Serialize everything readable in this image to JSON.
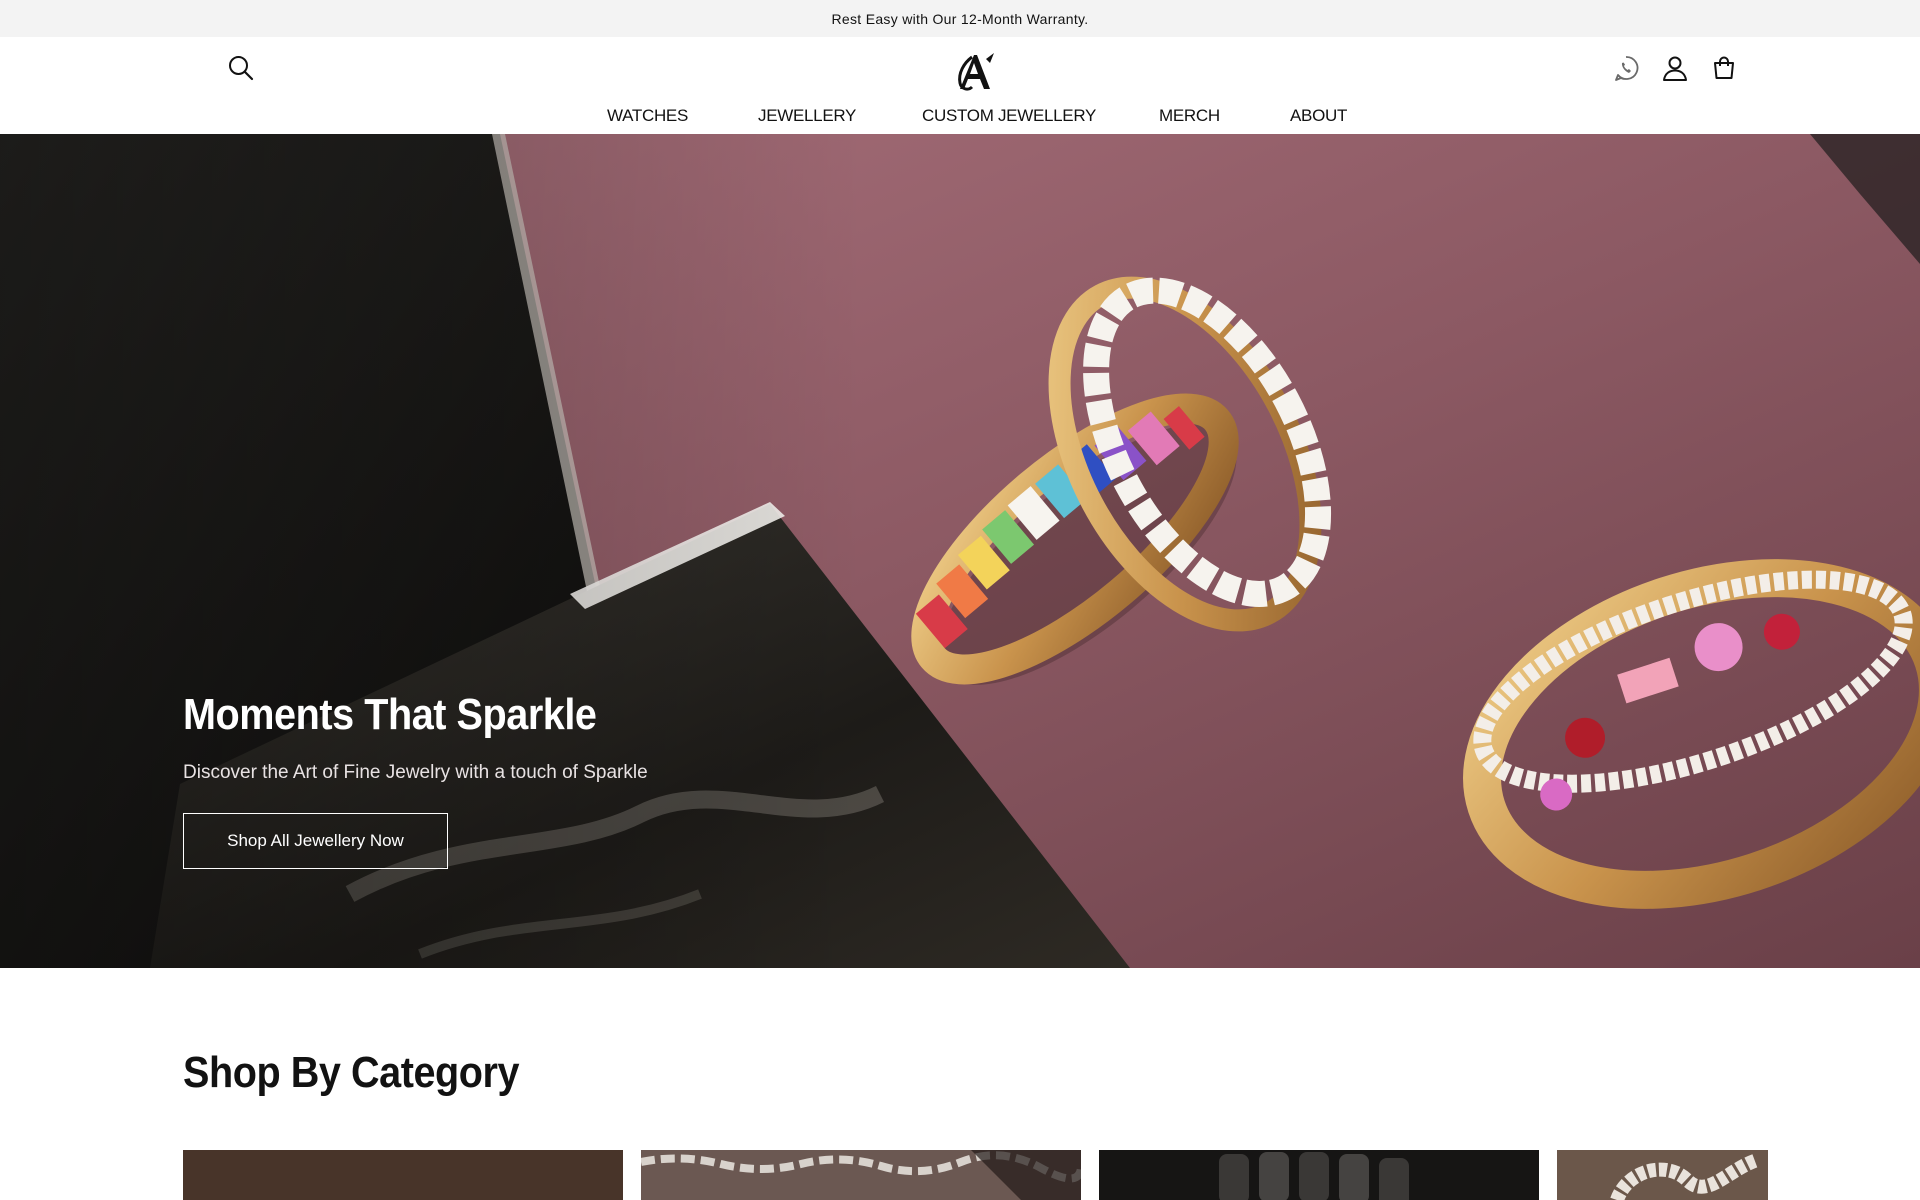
{
  "announcement": {
    "text": "Rest Easy with Our 12-Month Warranty."
  },
  "header": {
    "brand_initials": "A",
    "icons": {
      "search": "search-icon",
      "whatsapp": "whatsapp-icon",
      "account": "account-icon",
      "cart": "cart-icon"
    },
    "nav": [
      {
        "label": "WATCHES"
      },
      {
        "label": "JEWELLERY"
      },
      {
        "label": "CUSTOM JEWELLERY"
      },
      {
        "label": "MERCH"
      },
      {
        "label": "ABOUT"
      }
    ]
  },
  "hero": {
    "title": "Moments That Sparkle",
    "subtitle": "Discover the Art of Fine Jewelry with a touch of Sparkle",
    "button_label": "Shop All Jewellery Now"
  },
  "categories": {
    "title": "Shop By Category"
  },
  "colors": {
    "announcement_bg": "#f3f3f3",
    "hero_backdrop": "#7a5158",
    "text": "#121212"
  }
}
